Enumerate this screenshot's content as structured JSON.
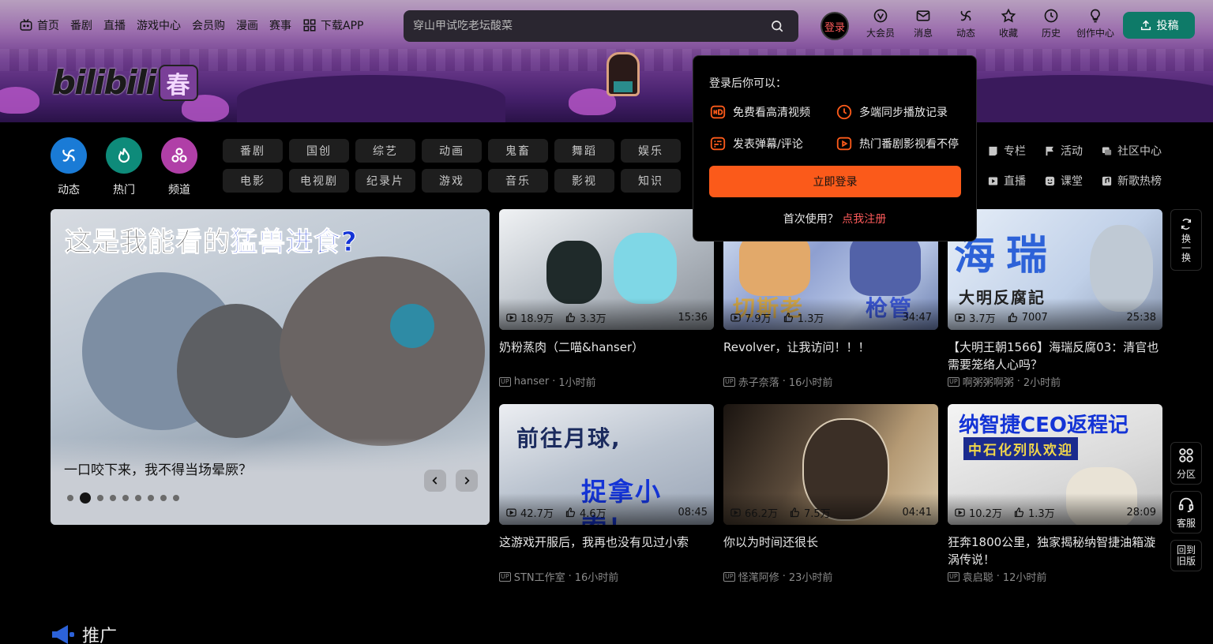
{
  "nav": {
    "left": [
      {
        "label": "首页",
        "icon": "tv-icon"
      },
      {
        "label": "番剧"
      },
      {
        "label": "直播"
      },
      {
        "label": "游戏中心"
      },
      {
        "label": "会员购"
      },
      {
        "label": "漫画"
      },
      {
        "label": "赛事"
      },
      {
        "label": "下载APP",
        "icon": "qr-grid-icon"
      }
    ],
    "search_placeholder": "穿山甲试吃老坛酸菜",
    "login_label": "登录",
    "right": [
      {
        "label": "大会员",
        "icon": "vip-icon"
      },
      {
        "label": "消息",
        "icon": "mail-icon"
      },
      {
        "label": "动态",
        "icon": "pinwheel-icon"
      },
      {
        "label": "收藏",
        "icon": "star-icon"
      },
      {
        "label": "历史",
        "icon": "clock-icon"
      },
      {
        "label": "创作中心",
        "icon": "bulb-icon"
      }
    ],
    "upload_label": "投稿"
  },
  "logo_text": "bilibili",
  "logo_seal": "春",
  "primary_channels": [
    {
      "label": "动态",
      "color": "#1a7bd6"
    },
    {
      "label": "热门",
      "color": "#0e8b7a"
    },
    {
      "label": "频道",
      "color": "#b03fa7"
    }
  ],
  "channels": [
    "番剧",
    "国创",
    "综艺",
    "动画",
    "鬼畜",
    "舞蹈",
    "娱乐",
    "电影",
    "电视剧",
    "纪录片",
    "游戏",
    "音乐",
    "影视",
    "知识"
  ],
  "extra_links": [
    {
      "label": "专栏",
      "icon": "column-icon"
    },
    {
      "label": "活动",
      "icon": "flag-icon"
    },
    {
      "label": "社区中心",
      "icon": "community-icon"
    },
    {
      "label": "直播",
      "icon": "live-icon"
    },
    {
      "label": "课堂",
      "icon": "class-icon"
    },
    {
      "label": "新歌热榜",
      "icon": "music-icon"
    }
  ],
  "carousel": {
    "headline_black": "这是我能看的",
    "headline_blue": "猛兽进食?",
    "title": "一口咬下来，我不得当场晕厥？",
    "dots": 9,
    "active_dot": 1
  },
  "videos": [
    {
      "views": "18.9万",
      "likes": "3.3万",
      "duration": "15:36",
      "title": "奶粉蒸肉（二喵&hanser）",
      "up": "hanser",
      "time": "1小时前",
      "bg": "#cfd3d9"
    },
    {
      "views": "7.9万",
      "likes": "1.3万",
      "duration": "34:47",
      "title": "Revolver，让我访问！！！",
      "up": "赤子奈落",
      "time": "16小时前",
      "bg": "#a9b8d6",
      "overlay_text": "切斯老",
      "overlay_text_2": "枪管"
    },
    {
      "views": "3.7万",
      "likes": "7007",
      "duration": "25:38",
      "title": "【大明王朝1566】海瑞反腐03：清官也需要笼络人心吗？",
      "up": "啊粥粥啊粥",
      "time": "2小时前",
      "bg": "#c8d4e8",
      "overlay_text": "海瑞",
      "overlay_text_2": "大明反腐記"
    },
    {
      "views": "42.7万",
      "likes": "4.6万",
      "duration": "08:45",
      "title": "这游戏开服后，我再也没有见过小索",
      "up": "STN工作室",
      "time": "16小时前",
      "bg": "#c6cbd2",
      "overlay_text": "前往月球,",
      "overlay_text_2": "捉拿小索！"
    },
    {
      "views": "66.2万",
      "likes": "7.5万",
      "duration": "04:41",
      "title": "你以为时间还很长",
      "up": "怪滗阿修",
      "time": "23小时前",
      "bg": "#6f6255"
    },
    {
      "views": "10.2万",
      "likes": "1.3万",
      "duration": "28:09",
      "title": "狂奔1800公里，独家揭秘纳智捷油箱漩涡传说！",
      "up": "袁启聪",
      "time": "12小时前",
      "bg": "#e6e6e6",
      "overlay_text": "纳智捷CEO返程记",
      "overlay_text_2": "中石化列队欢迎"
    }
  ],
  "floating": {
    "refresh": "换一换",
    "category": "分区",
    "service": "客服",
    "old_version": "回到旧版"
  },
  "promo_label": "推广",
  "login_popover": {
    "title": "登录后你可以：",
    "features": [
      {
        "label": "免费看高清视频",
        "icon": "hd-icon"
      },
      {
        "label": "多端同步播放记录",
        "icon": "sync-clock-icon"
      },
      {
        "label": "发表弹幕/评论",
        "icon": "danmaku-icon"
      },
      {
        "label": "热门番剧影视看不停",
        "icon": "play-icon"
      }
    ],
    "login_button": "立即登录",
    "register_prompt": "首次使用？",
    "register_link": "点我注册"
  },
  "colors": {
    "accent_orange": "#fb5a1a",
    "accent_red": "#fb5a5a",
    "upload_green": "#0e7a68"
  }
}
